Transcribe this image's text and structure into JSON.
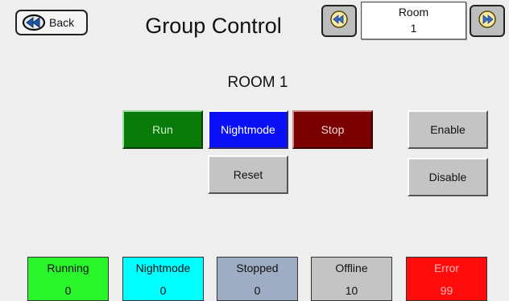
{
  "header": {
    "back_label": "Back",
    "title": "Group Control",
    "room_caption": "Room",
    "room_number": "1",
    "prev_icon": "rewind-icon",
    "next_icon": "fast-forward-icon"
  },
  "main": {
    "room_heading": "ROOM 1",
    "buttons": {
      "run": "Run",
      "nightmode": "Nightmode",
      "stop": "Stop",
      "reset": "Reset",
      "enable": "Enable",
      "disable": "Disable"
    }
  },
  "status": [
    {
      "label": "Running",
      "value": "0",
      "color": "#2af52a"
    },
    {
      "label": "Nightmode",
      "value": "0",
      "color": "#00ffff"
    },
    {
      "label": "Stopped",
      "value": "0",
      "color": "#9eadc3"
    },
    {
      "label": "Offline",
      "value": "10",
      "color": "#c4c4c4"
    },
    {
      "label": "Error",
      "value": "99",
      "color": "#ff0d0d"
    }
  ]
}
